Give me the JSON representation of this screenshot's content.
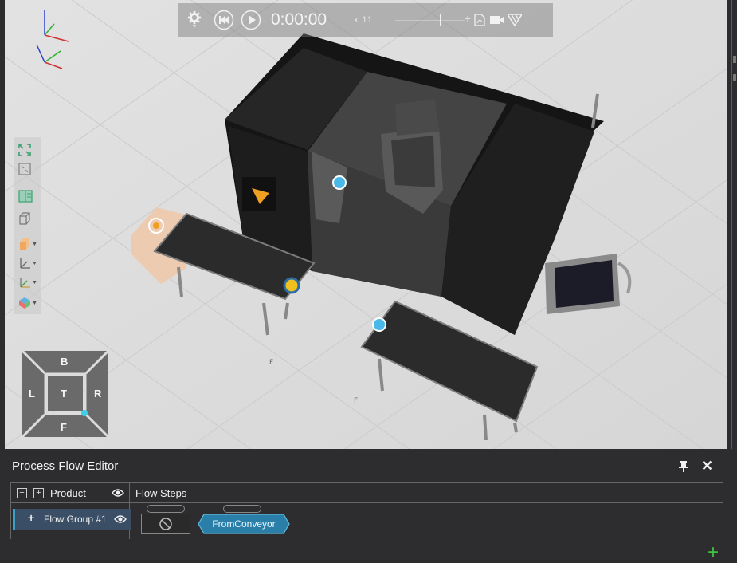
{
  "playback": {
    "time": "0:00:00",
    "speed": "x 11",
    "icons": [
      "gear-icon",
      "rewind-icon",
      "play-icon",
      "pdf-icon",
      "video-camera-icon",
      "brand-logo-icon"
    ]
  },
  "navcube": {
    "top": "B",
    "left": "L",
    "center": "T",
    "right": "R",
    "bottom": "F"
  },
  "viewtools": {
    "icons": [
      "fit-to-view-icon",
      "zoom-to-fit-icon",
      "split-view-icon",
      "box-outline-icon",
      "box-shaded-icon",
      "axes-icon",
      "axes-green-icon",
      "render-mode-icon"
    ]
  },
  "panel": {
    "title": "Process Flow Editor",
    "header_product": "Product",
    "header_flow_steps": "Flow Steps",
    "group_name": "Flow Group #1",
    "step_name": "FromConveyor"
  },
  "colors": {
    "accent": "#3aa0c8",
    "step_fill": "#2a7fa8",
    "add_green": "#3ec83e",
    "panel_bg": "#2d2d30"
  }
}
